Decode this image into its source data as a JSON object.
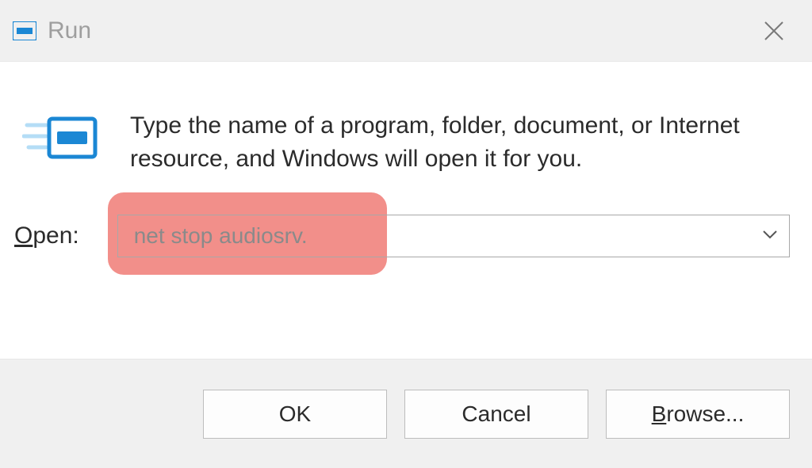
{
  "titlebar": {
    "title": "Run"
  },
  "content": {
    "instruction": "Type the name of a program, folder, document, or Internet resource, and Windows will open it for you."
  },
  "form": {
    "open_label_underlined": "O",
    "open_label_rest": "pen:",
    "command_value": "net stop audiosrv."
  },
  "buttons": {
    "ok": "OK",
    "cancel": "Cancel",
    "browse_underlined": "B",
    "browse_rest": "rowse..."
  }
}
